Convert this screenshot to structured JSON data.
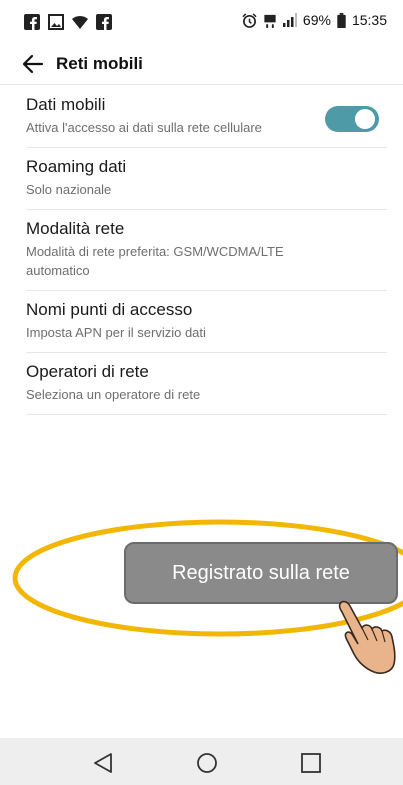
{
  "status_bar": {
    "battery": "69%",
    "time": "15:35",
    "left_icons": [
      "facebook-icon",
      "image-icon",
      "wifi-icon",
      "facebook-icon"
    ],
    "right_icons": [
      "alarm-icon",
      "data-icon",
      "signal-icon",
      "battery-icon"
    ]
  },
  "toolbar": {
    "title": "Reti mobili"
  },
  "settings": [
    {
      "title": "Dati mobili",
      "subtitle": "Attiva l'accesso ai dati sulla rete cellulare",
      "toggle_on": true
    },
    {
      "title": "Roaming dati",
      "subtitle": "Solo nazionale"
    },
    {
      "title": "Modalità rete",
      "subtitle": "Modalità di rete preferita: GSM/WCDMA/LTE automatico"
    },
    {
      "title": "Nomi punti di accesso",
      "subtitle": "Imposta APN per il servizio dati"
    },
    {
      "title": "Operatori di rete",
      "subtitle": "Seleziona un operatore di rete"
    }
  ],
  "tooltip": {
    "text": "Registrato sulla rete"
  },
  "colors": {
    "accent": "#4e9ba7",
    "highlight_ellipse": "#f2b705",
    "tooltip_bg": "#8a8a8a"
  }
}
